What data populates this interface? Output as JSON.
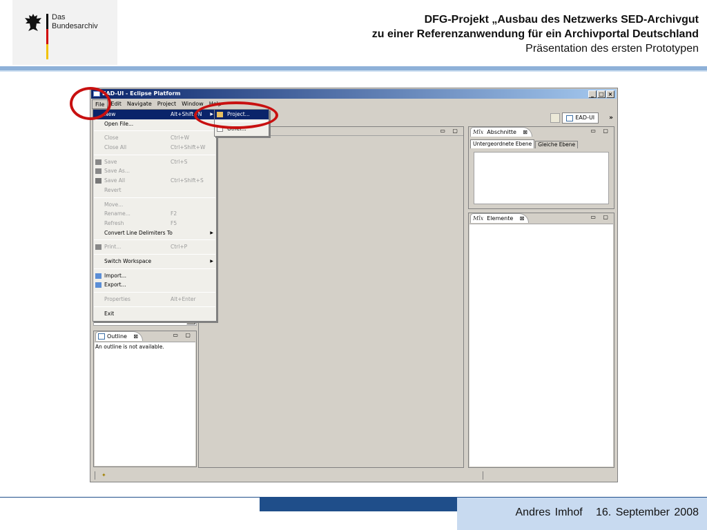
{
  "header": {
    "logo_text_1": "Das",
    "logo_text_2": "Bundesarchiv",
    "title_line1": "DFG-Projekt „Ausbau des Netzwerks SED-Archivgut",
    "title_line2": "zu einer Referenzanwendung für ein Archivportal Deutschland",
    "title_line3": "Präsentation des ersten Prototypen"
  },
  "footer": {
    "author": "Andres Imhof",
    "date": "16. September 2008"
  },
  "window": {
    "title": "EAD-UI - Eclipse Platform",
    "buttons": [
      "_",
      "□",
      "×"
    ]
  },
  "menubar": [
    "File",
    "Edit",
    "Navigate",
    "Project",
    "Window",
    "Help"
  ],
  "toolbar": {
    "perspective": "EAD-UI",
    "more": "»"
  },
  "file_menu": {
    "new": {
      "label": "New",
      "accel": "Alt+Shift+N"
    },
    "open_file": {
      "label": "Open File..."
    },
    "close": {
      "label": "Close",
      "accel": "Ctrl+W"
    },
    "close_all": {
      "label": "Close All",
      "accel": "Ctrl+Shift+W"
    },
    "save": {
      "label": "Save",
      "accel": "Ctrl+S"
    },
    "save_as": {
      "label": "Save As..."
    },
    "save_all": {
      "label": "Save All",
      "accel": "Ctrl+Shift+S"
    },
    "revert": {
      "label": "Revert"
    },
    "move": {
      "label": "Move..."
    },
    "rename": {
      "label": "Rename...",
      "accel": "F2"
    },
    "refresh": {
      "label": "Refresh",
      "accel": "F5"
    },
    "convert": {
      "label": "Convert Line Delimiters To"
    },
    "print": {
      "label": "Print...",
      "accel": "Ctrl+P"
    },
    "switch_ws": {
      "label": "Switch Workspace"
    },
    "import": {
      "label": "Import..."
    },
    "export": {
      "label": "Export..."
    },
    "properties": {
      "label": "Properties",
      "accel": "Alt+Enter"
    },
    "exit": {
      "label": "Exit"
    }
  },
  "new_submenu": {
    "project": "Project...",
    "other": "Other..."
  },
  "views": {
    "abschnitte": {
      "tab": "Abschnitte",
      "prefix": "Mlx",
      "subtab_active": "Untergeordnete Ebene",
      "subtab_other": "Gleiche Ebene"
    },
    "elemente": {
      "tab": "Elemente",
      "prefix": "Mlx"
    },
    "outline": {
      "tab": "Outline",
      "message": "An outline is not available."
    },
    "view_controls": "▭ ▢",
    "close_glyph": "⊠"
  },
  "colors": {
    "selection": "#0a246a",
    "highlight_circle": "#c81010",
    "slide_band": "#8eb1d8",
    "footer_dark": "#1f4e8a",
    "footer_light": "#c8daf0"
  }
}
